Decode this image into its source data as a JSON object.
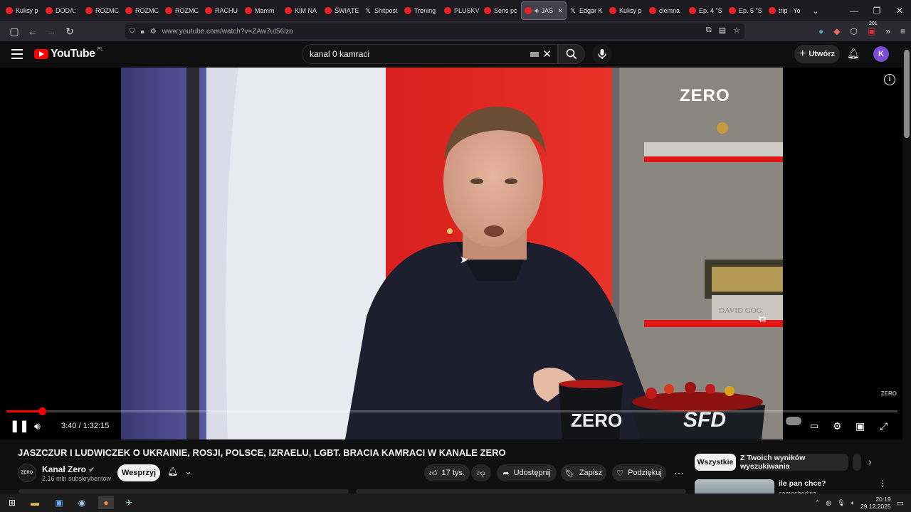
{
  "browser": {
    "tabs": [
      {
        "label": "Kulisy p",
        "icon": "youtube-icon"
      },
      {
        "label": "DODA:",
        "icon": "youtube-icon"
      },
      {
        "label": "ROZMC",
        "icon": "youtube-icon"
      },
      {
        "label": "ROZMC",
        "icon": "youtube-icon"
      },
      {
        "label": "ROZMC",
        "icon": "youtube-icon"
      },
      {
        "label": "RACHU",
        "icon": "youtube-icon"
      },
      {
        "label": "Mamm",
        "icon": "youtube-icon"
      },
      {
        "label": "KIM NA",
        "icon": "youtube-icon"
      },
      {
        "label": "ŚWIĄTE",
        "icon": "youtube-icon"
      },
      {
        "label": "Shitpost",
        "icon": "x-icon"
      },
      {
        "label": "Trening",
        "icon": "youtube-icon"
      },
      {
        "label": "PLUSKV",
        "icon": "youtube-icon"
      },
      {
        "label": "Sens pc",
        "icon": "youtube-icon"
      },
      {
        "label": "JAS",
        "icon": "youtube-icon",
        "active": true
      },
      {
        "label": "Edgar K",
        "icon": "x-icon"
      },
      {
        "label": "Kulisy p",
        "icon": "youtube-icon"
      },
      {
        "label": "ciemna",
        "icon": "youtube-icon"
      },
      {
        "label": "Ep. 4 \"S",
        "icon": "youtube-icon"
      },
      {
        "label": "Ep. 5 \"S",
        "icon": "youtube-icon"
      },
      {
        "label": "trip - Yo",
        "icon": "youtube-icon"
      }
    ],
    "url": "www.youtube.com/watch?v=ZAw7uI56izo",
    "extension_badge": "201"
  },
  "youtube": {
    "logo_text": "YouTube",
    "region": "PL",
    "search_value": "kanal 0 kamraci",
    "create_label": "Utwórz",
    "avatar_letter": "K"
  },
  "player": {
    "current_time": "3:40",
    "duration": "1:32:15",
    "time_separator": "/",
    "progress_fraction": 0.0397,
    "buffered_fraction": 0.05,
    "watermark": "ZERO",
    "studio_logo": "ZERO",
    "mug_logo": "ZERO",
    "bowl_logo": "SFD",
    "book_spine": "DAVID GOG"
  },
  "video": {
    "title": "JASZCZUR I LUDWICZEK O UKRAINIE, ROSJI, POLSCE, IZRAELU, LGBT. BRACIA KAMRACI W KANALE ZERO",
    "channel_name": "Kanał Zero",
    "channel_avatar_text": "ZERO",
    "subscribers": "2,16 mln subskrybentów",
    "support_label": "Wesprzyj",
    "likes": "17 tys.",
    "share_label": "Udostępnij",
    "save_label": "Zapisz",
    "thanks_label": "Podziękuj"
  },
  "chips": {
    "all": "Wszystkie",
    "from_search": "Z Twoich wyników wyszukiwania"
  },
  "recommendation": {
    "title": "ile pan chce?",
    "channel": "samosbodzia"
  },
  "taskbar": {
    "time": "20:19",
    "date": "29.12.2025"
  },
  "colors": {
    "accent": "#ff0000",
    "background": "#0f0f0f"
  }
}
